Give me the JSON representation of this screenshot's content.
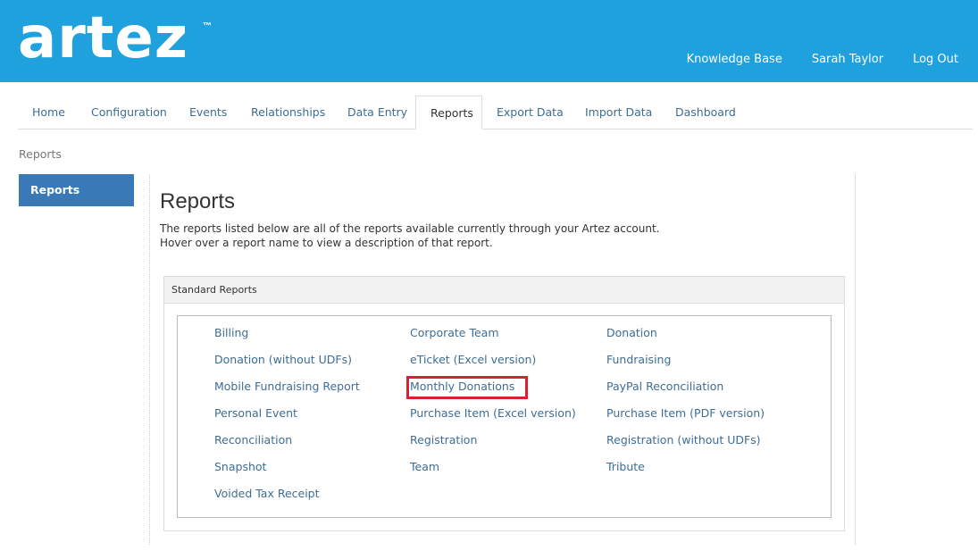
{
  "header": {
    "logo_text": "artez",
    "logo_tm": "™",
    "links": [
      "Knowledge Base",
      "Sarah Taylor",
      "Log Out"
    ],
    "bg_color": "#1ea1dc"
  },
  "tabs": [
    {
      "label": "Home",
      "active": false
    },
    {
      "label": "Configuration",
      "active": false
    },
    {
      "label": "Events",
      "active": false
    },
    {
      "label": "Relationships",
      "active": false
    },
    {
      "label": "Data Entry",
      "active": false
    },
    {
      "label": "Reports",
      "active": true
    },
    {
      "label": "Export Data",
      "active": false
    },
    {
      "label": "Import Data",
      "active": false
    },
    {
      "label": "Dashboard",
      "active": false
    }
  ],
  "breadcrumb": "Reports",
  "sidebar": {
    "items": [
      {
        "label": "Reports",
        "active": true
      }
    ],
    "active_color": "#3979b8"
  },
  "main": {
    "title": "Reports",
    "intro_line1": "The reports listed below are all of the reports available currently through your Artez account.",
    "intro_line2": "Hover over a report name to view a description of that report.",
    "panel": {
      "heading": "Standard Reports",
      "reports": [
        [
          "Billing",
          "Corporate Team",
          "Donation"
        ],
        [
          "Donation (without UDFs)",
          "eTicket (Excel version)",
          "Fundraising"
        ],
        [
          "Mobile Fundraising Report",
          "Monthly Donations",
          "PayPal Reconciliation"
        ],
        [
          "Personal Event",
          "Purchase Item (Excel version)",
          "Purchase Item (PDF version)"
        ],
        [
          "Reconciliation",
          "Registration",
          "Registration (without UDFs)"
        ],
        [
          "Snapshot",
          "Team",
          "Tribute"
        ],
        [
          "Voided Tax Receipt"
        ]
      ],
      "highlighted": "Monthly Donations",
      "link_color": "#3e6d94",
      "highlight_color": "#d7222f"
    }
  }
}
